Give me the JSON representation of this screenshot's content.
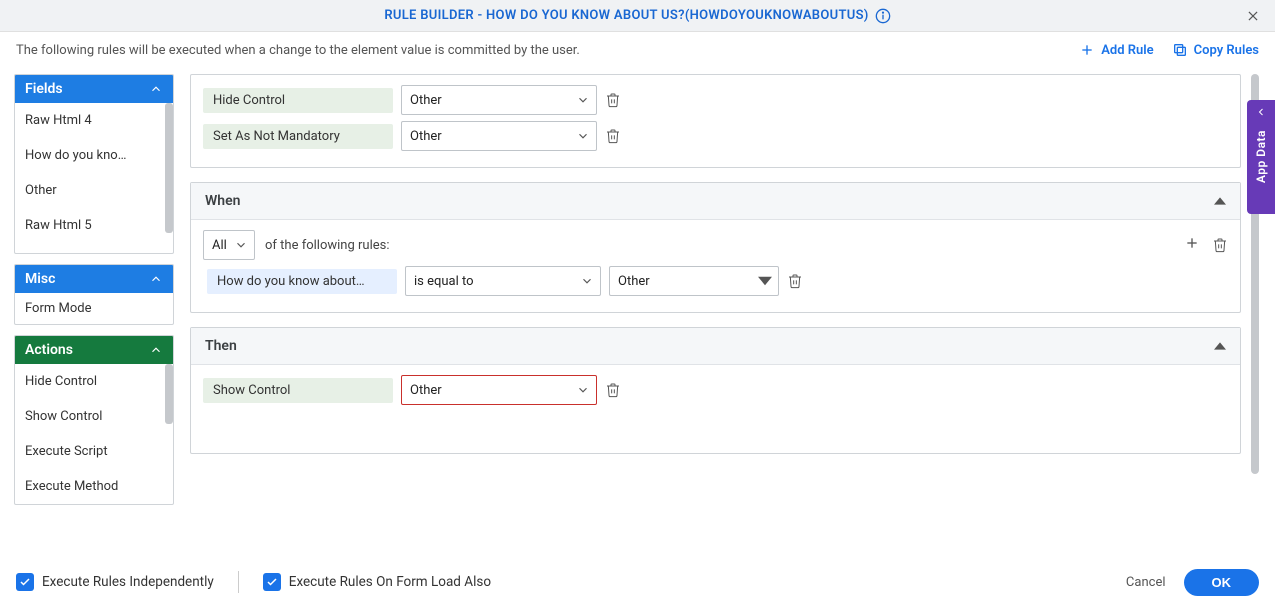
{
  "header": {
    "title": "RULE BUILDER - HOW DO YOU KNOW ABOUT US?(HOWDOYOUKNOWABOUTUS)"
  },
  "toolbar": {
    "description": "The following rules will be executed when a change to the element value is committed by the user.",
    "add_rule": "Add Rule",
    "copy_rules": "Copy Rules"
  },
  "sidebar": {
    "fields": {
      "title": "Fields",
      "items": [
        "Raw Html 4",
        "How do you kno…",
        "Other",
        "Raw Html 5"
      ]
    },
    "misc": {
      "title": "Misc",
      "items": [
        "Form Mode"
      ]
    },
    "actions": {
      "title": "Actions",
      "items": [
        "Hide Control",
        "Show Control",
        "Execute Script",
        "Execute Method"
      ]
    }
  },
  "rules": {
    "top_block": {
      "rows": [
        {
          "action": "Hide Control",
          "value": "Other"
        },
        {
          "action": "Set As Not Mandatory",
          "value": "Other"
        }
      ]
    },
    "when": {
      "title": "When",
      "quantifier": "All",
      "suffix": "of the following rules:",
      "rows": [
        {
          "field": "How do you know about…",
          "op": "is equal to",
          "value": "Other"
        }
      ]
    },
    "then": {
      "title": "Then",
      "rows": [
        {
          "action": "Show Control",
          "value": "Other"
        }
      ]
    }
  },
  "dock": {
    "label": "App Data"
  },
  "footer": {
    "chk1": "Execute Rules Independently",
    "chk2": "Execute Rules On Form Load Also",
    "cancel": "Cancel",
    "ok": "OK"
  }
}
